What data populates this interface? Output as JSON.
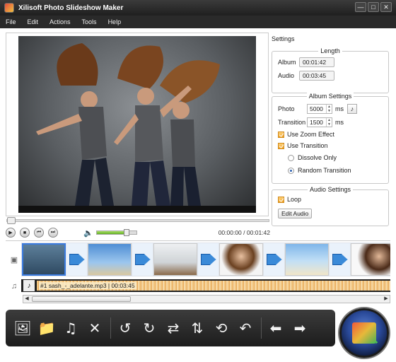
{
  "window": {
    "title": "Xilisoft Photo Slideshow Maker",
    "controls": [
      "—",
      "□",
      "✕"
    ]
  },
  "menu": [
    "File",
    "Edit",
    "Actions",
    "Tools",
    "Help"
  ],
  "playback": {
    "current_time": "00:00:00",
    "total_time": "00:01:42",
    "separator": "/",
    "volume_level": 0.75
  },
  "settings": {
    "title": "Settings",
    "length": {
      "title": "Length",
      "album_label": "Album",
      "album_value": "00:01:42",
      "audio_label": "Audio",
      "audio_value": "00:03:45"
    },
    "album": {
      "title": "Album Settings",
      "photo_label": "Photo",
      "photo_value": "5000",
      "photo_unit": "ms",
      "transition_label": "Transition",
      "transition_value": "1500",
      "transition_unit": "ms",
      "zoom_effect": "Use Zoom Effect",
      "use_transition": "Use Transition",
      "dissolve_only": "Dissolve Only",
      "random_transition": "Random Transition"
    },
    "audio": {
      "title": "Audio Settings",
      "loop": "Loop",
      "edit_button": "Edit Audio"
    }
  },
  "timeline": {
    "audio_clip": "#1 sash_-_adelante.mp3 | 00:03:45"
  },
  "icons": {
    "add_photo": "🖼",
    "add_folder": "📁",
    "add_music": "♫",
    "delete": "✕",
    "rotate_left": "↺",
    "rotate_right": "↻",
    "flip_h": "⇄",
    "flip_v": "⇅",
    "effect": "⟲",
    "undo": "↶",
    "move_left": "⬅",
    "move_right": "➡",
    "play": "▶",
    "stop": "■",
    "prev": "⏮",
    "next": "⏭",
    "volume": "🔈",
    "photo_track": "▣",
    "music_track": "♫",
    "note": "♪"
  }
}
